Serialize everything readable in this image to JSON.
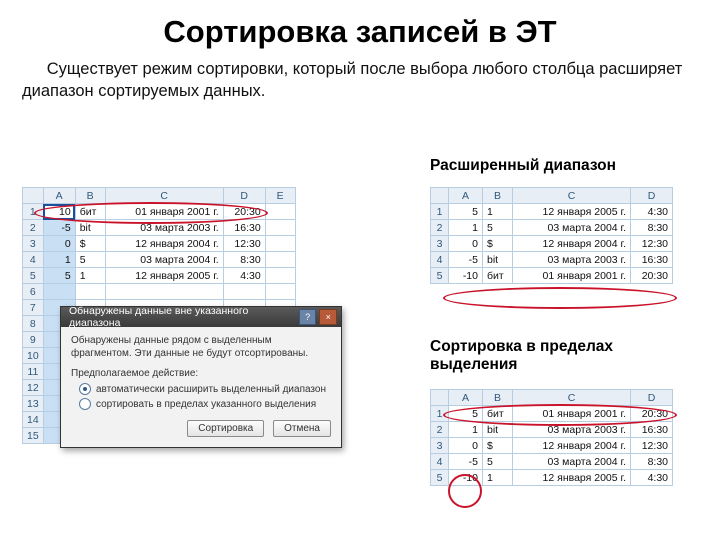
{
  "title": "Сортировка записей в ЭТ",
  "intro": "Существует режим сортировки, который после выбора любого столбца расширяет диапазон сортируемых данных.",
  "subheads": {
    "expanded": "Расширенный диапазон",
    "within": "Сортировка в пределах выделения"
  },
  "cols": [
    "A",
    "B",
    "C",
    "D",
    "E"
  ],
  "cols4": [
    "A",
    "B",
    "C",
    "D"
  ],
  "left_table": {
    "rows": [
      {
        "n": "1",
        "a": "10",
        "b": "бит",
        "c": "01 января 2001 г.",
        "d": "20:30"
      },
      {
        "n": "2",
        "a": "-5",
        "b": "bit",
        "c": "03 марта 2003 г.",
        "d": "16:30"
      },
      {
        "n": "3",
        "a": "0",
        "b": "$",
        "c": "12 января 2004 г.",
        "d": "12:30"
      },
      {
        "n": "4",
        "a": "1",
        "b": "5",
        "c": "03 марта 2004 г.",
        "d": "8:30"
      },
      {
        "n": "5",
        "a": "5",
        "b": "1",
        "c": "12 января 2005 г.",
        "d": "4:30"
      }
    ],
    "empty_rows": [
      "6",
      "7",
      "8",
      "9",
      "10",
      "11",
      "12",
      "13",
      "14",
      "15"
    ]
  },
  "right_top": {
    "rows": [
      {
        "n": "1",
        "a": "5",
        "b": "1",
        "c": "12 января 2005 г.",
        "d": "4:30"
      },
      {
        "n": "2",
        "a": "1",
        "b": "5",
        "c": "03 марта 2004 г.",
        "d": "8:30"
      },
      {
        "n": "3",
        "a": "0",
        "b": "$",
        "c": "12 января 2004 г.",
        "d": "12:30"
      },
      {
        "n": "4",
        "a": "-5",
        "b": "bit",
        "c": "03 марта 2003 г.",
        "d": "16:30"
      },
      {
        "n": "5",
        "a": "-10",
        "b": "бит",
        "c": "01 января 2001 г.",
        "d": "20:30"
      }
    ]
  },
  "right_bottom": {
    "rows": [
      {
        "n": "1",
        "a": "5",
        "b": "бит",
        "c": "01 января 2001 г.",
        "d": "20:30"
      },
      {
        "n": "2",
        "a": "1",
        "b": "bit",
        "c": "03 марта 2003 г.",
        "d": "16:30"
      },
      {
        "n": "3",
        "a": "0",
        "b": "$",
        "c": "12 января 2004 г.",
        "d": "12:30"
      },
      {
        "n": "4",
        "a": "-5",
        "b": "5",
        "c": "03 марта 2004 г.",
        "d": "8:30"
      },
      {
        "n": "5",
        "a": "-10",
        "b": "1",
        "c": "12 января 2005 г.",
        "d": "4:30"
      }
    ]
  },
  "dialog": {
    "title": "Обнаружены данные вне указанного диапазона",
    "help": "?",
    "close": "×",
    "message": "Обнаружены данные рядом с выделенным фрагментом. Эти данные не будут отсортированы.",
    "prompt": "Предполагаемое действие:",
    "opt_expand": "автоматически расширить выделенный диапазон",
    "opt_within": "сортировать в пределах указанного выделения",
    "btn_sort": "Сортировка",
    "btn_cancel": "Отмена"
  }
}
